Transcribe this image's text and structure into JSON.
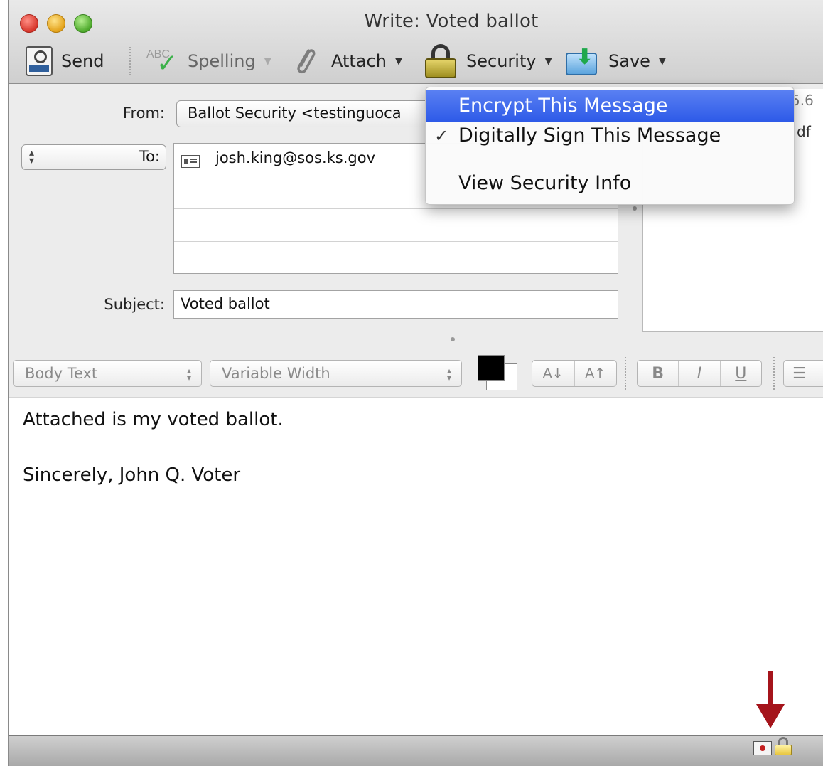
{
  "window": {
    "title": "Write: Voted ballot"
  },
  "toolbar": {
    "send_label": "Send",
    "spelling_label": "Spelling",
    "spelling_icon_text": "ABC",
    "attach_label": "Attach",
    "security_label": "Security",
    "save_label": "Save",
    "dropdown_caret": "▼"
  },
  "header": {
    "from_label": "From:",
    "from_value": "Ballot Security <testinguoca",
    "to_label": "To:",
    "to_recipients": [
      "josh.king@sos.ks.gov"
    ],
    "subject_label": "Subject:",
    "subject_value": "Voted ballot",
    "attachment_fragment_1": "5.6",
    "attachment_fragment_2": "df"
  },
  "format_bar": {
    "style_value": "Body Text",
    "font_value": "Variable Width",
    "text_color": "#000000",
    "background_color": "#ffffff",
    "decrease_size_label": "A↓",
    "increase_size_label": "A↑",
    "bold_label": "B",
    "italic_label": "I",
    "underline_label": "U"
  },
  "body": {
    "lines": [
      "Attached is my voted ballot.",
      "Sincerely, John Q. Voter"
    ]
  },
  "security_menu": {
    "items": [
      {
        "label": "Encrypt This Message",
        "highlighted": true,
        "checked": false
      },
      {
        "label": "Digitally Sign This Message",
        "highlighted": false,
        "checked": true
      },
      {
        "label": "View Security Info",
        "highlighted": false,
        "checked": false
      }
    ],
    "check_mark": "✓",
    "highlight_color": "#3b63eb"
  },
  "colors": {
    "annotation_arrow": "#a5141b",
    "window_background": "#ececec"
  }
}
